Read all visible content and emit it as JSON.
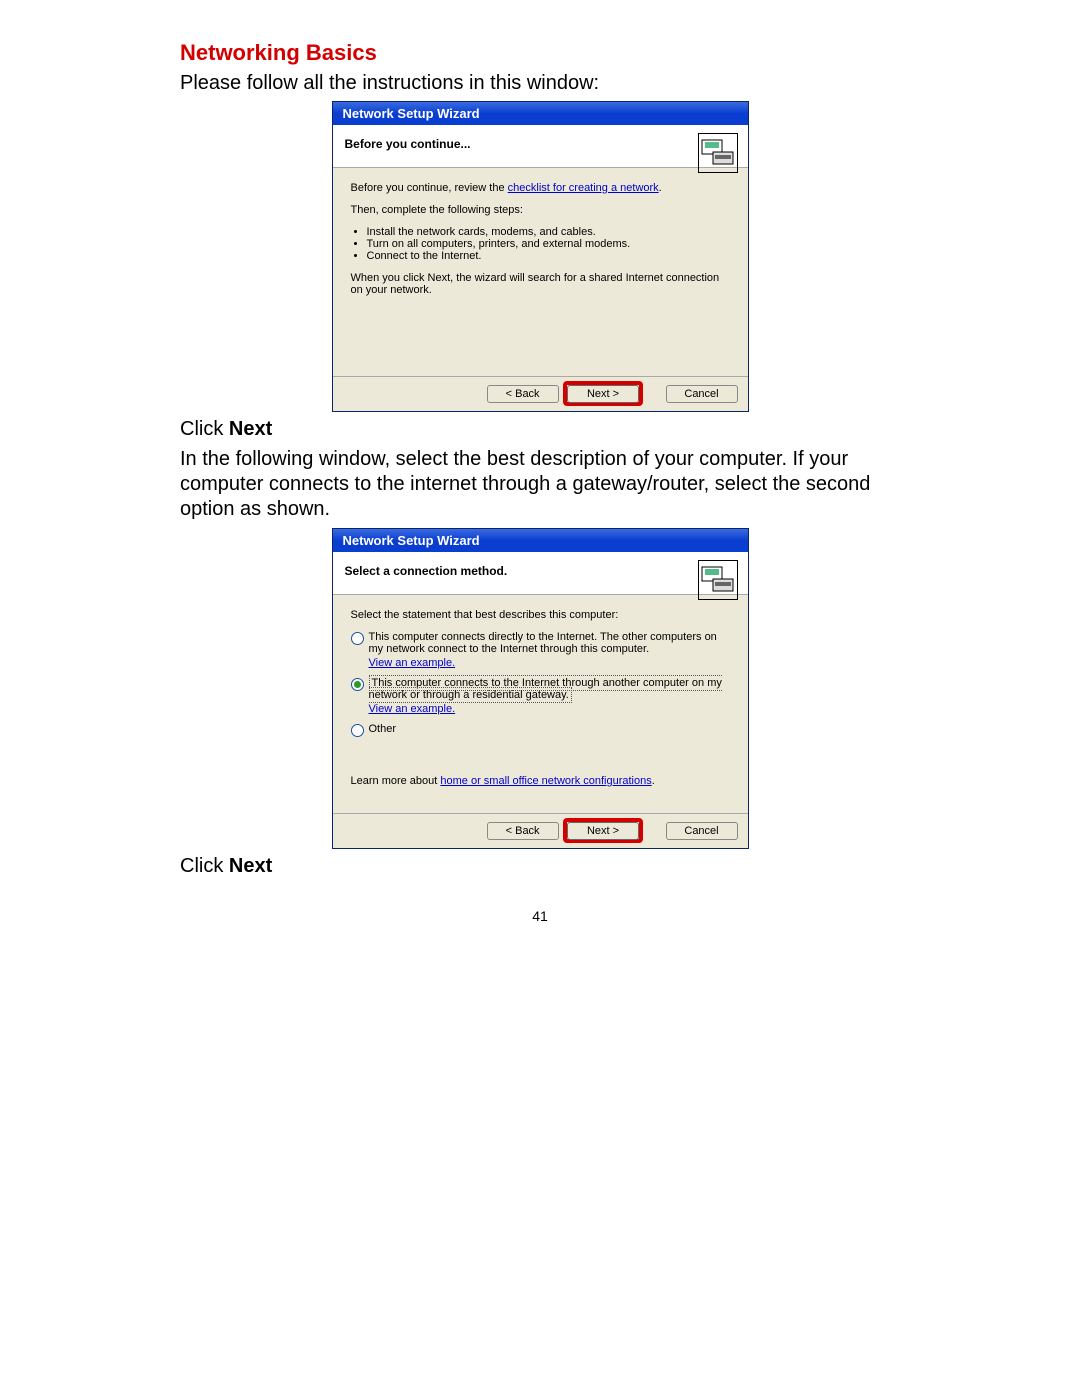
{
  "section_title": "Networking Basics",
  "intro": "Please follow all the instructions in this window:",
  "click_next_prefix": "Click ",
  "click_next_bold": "Next",
  "desc_block": "In the following window, select the best description of your computer.  If your computer connects to the internet through a gateway/router, select the second option as shown.",
  "page_number": "41",
  "wizard1": {
    "title": "Network Setup Wizard",
    "header": "Before you continue...",
    "review_prefix": "Before you continue, review the ",
    "review_link": "checklist for creating a network",
    "review_suffix": ".",
    "then_line": "Then, complete the following steps:",
    "steps": [
      "Install the network cards, modems, and cables.",
      "Turn on all computers, printers, and external modems.",
      "Connect to the Internet."
    ],
    "next_note": "When you click Next, the wizard will search for a shared Internet connection on your network.",
    "back": "< Back",
    "next": "Next >",
    "cancel": "Cancel"
  },
  "wizard2": {
    "title": "Network Setup Wizard",
    "header": "Select a connection method.",
    "select_stmt": "Select the statement that best describes this computer:",
    "opt1": "This computer connects directly to the Internet. The other computers on my network connect to the Internet through this computer.",
    "opt1_example": "View an example.",
    "opt2_part1": "This computer connects to the Internet through another computer on my network or through ",
    "opt2_part2": "a residential gateway.",
    "opt2_example": "View an example.",
    "opt_other": "Other",
    "learn_prefix": "Learn more about ",
    "learn_link": "home or small office network configurations",
    "learn_suffix": ".",
    "back": "< Back",
    "next": "Next >",
    "cancel": "Cancel"
  }
}
